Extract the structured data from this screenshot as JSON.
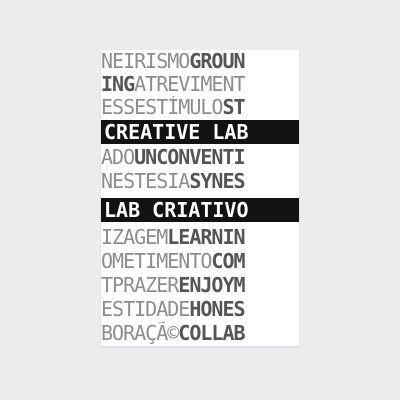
{
  "poster": {
    "lines": [
      {
        "light": "NEIRISMO",
        "dark": "GROUN"
      },
      {
        "light": "",
        "dark": "ING",
        "light2": "ATREVIMENT"
      },
      {
        "light": "ESS",
        "dark": "",
        "light2": "ESTÍMULO",
        "dark2": "ST"
      },
      {
        "band": "CREATIVE LAB"
      },
      {
        "light": "ADO",
        "dark": "UNCONVENTI"
      },
      {
        "light": "NESTESIA",
        "dark": "SYNES"
      },
      {
        "band": "LAB CRIATIVO"
      },
      {
        "light": "IZAGEM",
        "dark": "LEARNIN"
      },
      {
        "light": "OMETIMENTO",
        "dark": "COM"
      },
      {
        "light": "T",
        "dark": "",
        "light2": "PRAZER",
        "dark2": "ENJOYM"
      },
      {
        "light": "ESTIDADE",
        "dark": "HONES"
      },
      {
        "light": "BORAÇÃ©",
        "dark": "COLLAB"
      }
    ]
  }
}
